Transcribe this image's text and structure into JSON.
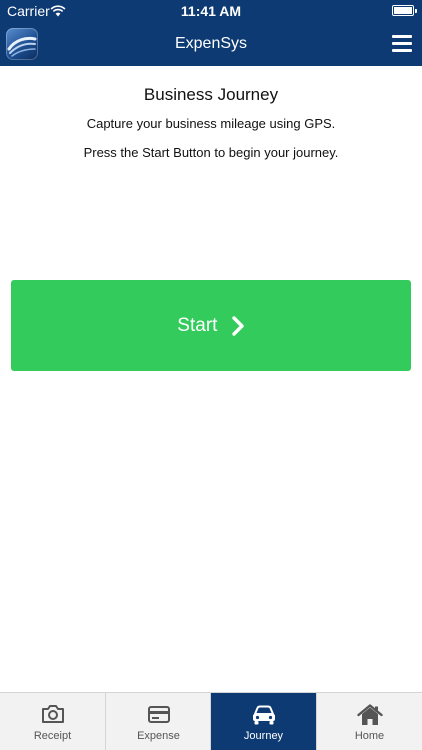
{
  "status": {
    "carrier": "Carrier",
    "time": "11:41 AM"
  },
  "header": {
    "title": "ExpenSys"
  },
  "main": {
    "title": "Business Journey",
    "line1": "Capture your business mileage using GPS.",
    "line2": "Press the Start Button to begin your journey.",
    "start_label": "Start",
    "start_color": "#33cc5c"
  },
  "tabs": [
    {
      "label": "Receipt",
      "icon": "camera-icon"
    },
    {
      "label": "Expense",
      "icon": "wallet-icon"
    },
    {
      "label": "Journey",
      "icon": "car-icon",
      "active": true
    },
    {
      "label": "Home",
      "icon": "home-icon"
    }
  ],
  "colors": {
    "brand": "#0d3a72",
    "tabbar": "#f2f2f2"
  }
}
